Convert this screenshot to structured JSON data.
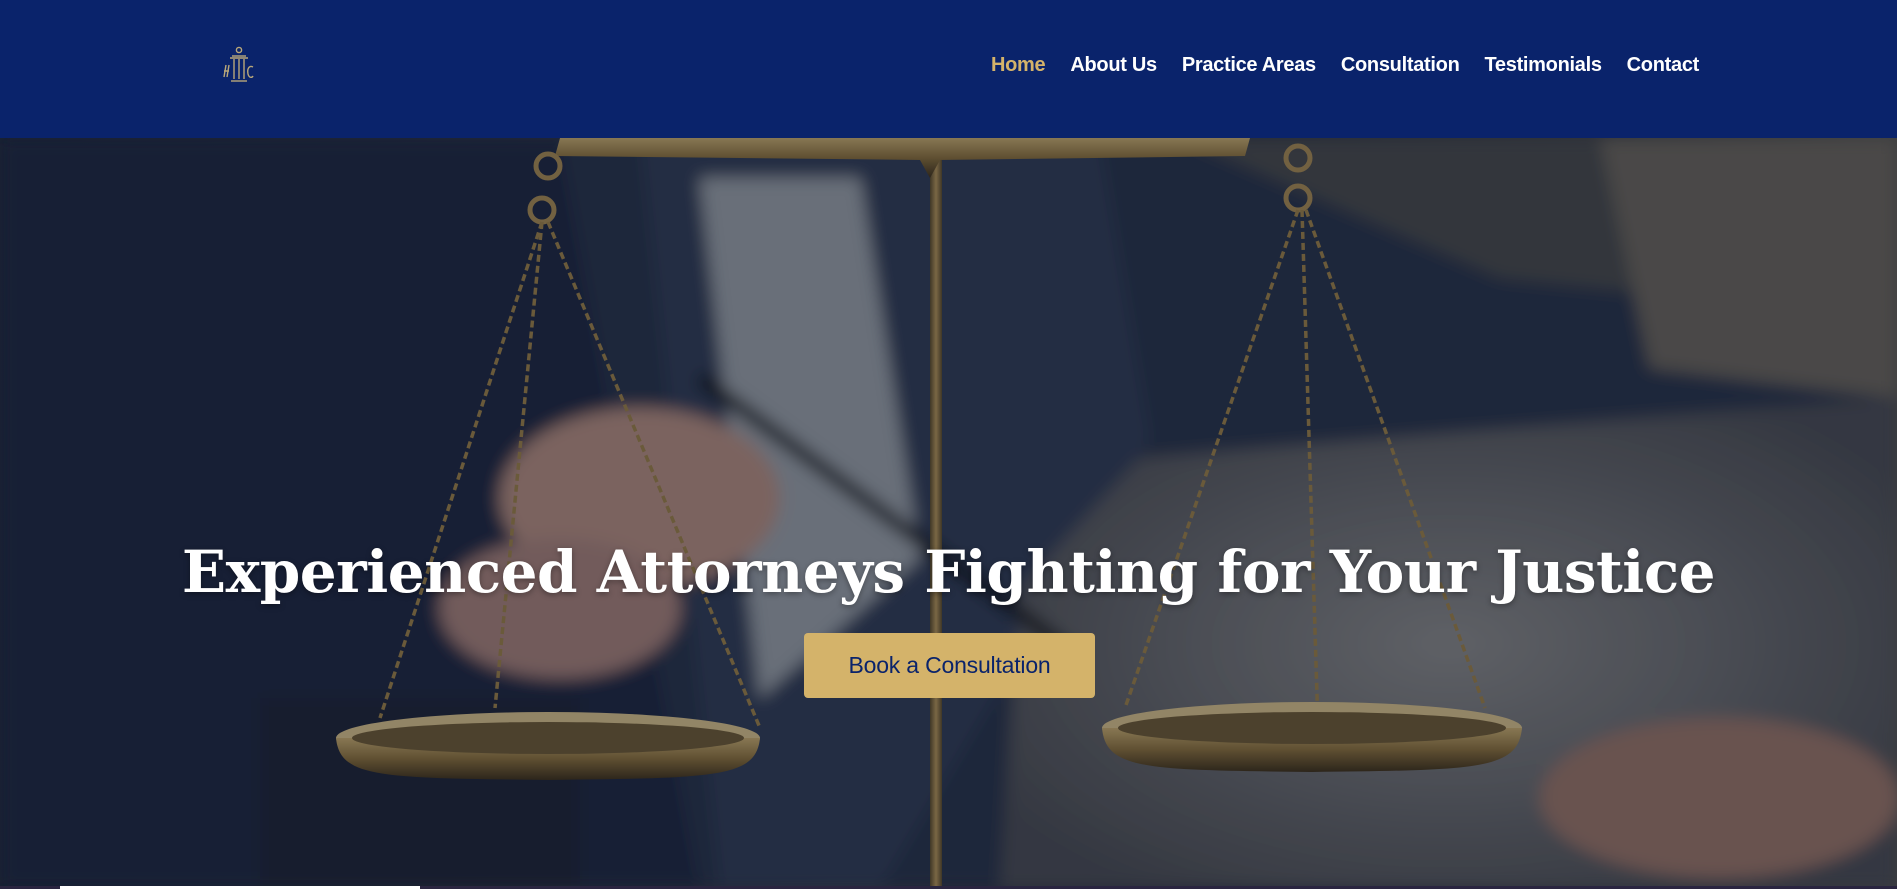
{
  "header": {
    "logo_icon": "law-firm-pillar-logo",
    "nav": [
      {
        "label": "Home",
        "active": true
      },
      {
        "label": "About Us",
        "active": false
      },
      {
        "label": "Practice Areas",
        "active": false
      },
      {
        "label": "Consultation",
        "active": false
      },
      {
        "label": "Testimonials",
        "active": false
      },
      {
        "label": "Contact",
        "active": false
      }
    ]
  },
  "hero": {
    "background_image": "scales-of-justice-with-attorney",
    "title": "Experienced Attorneys Fighting for Your Justice",
    "cta_label": "Book a Consultation"
  },
  "colors": {
    "navy": "#0a236b",
    "gold": "#d4b36a",
    "white": "#ffffff"
  }
}
